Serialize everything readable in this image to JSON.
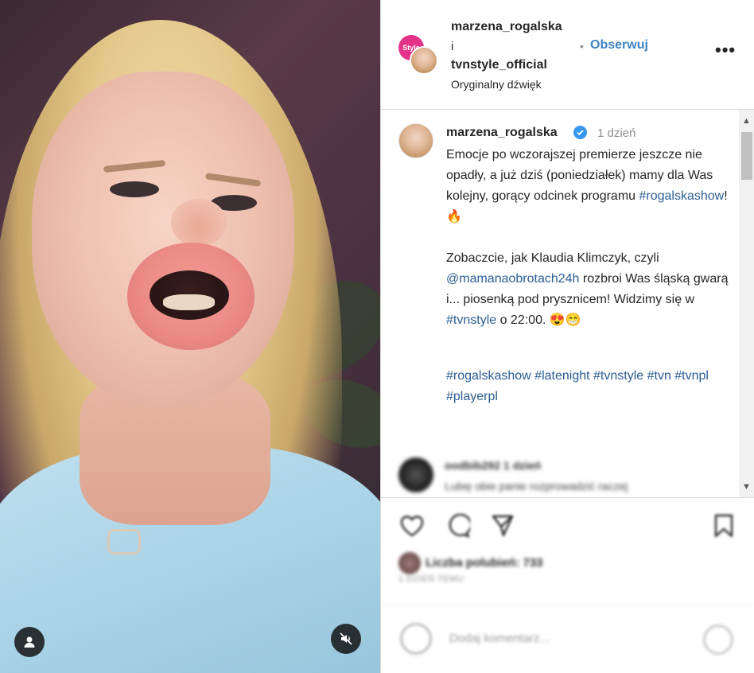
{
  "header": {
    "user1": "marzena_rogalska",
    "conjunction": "i",
    "user2": "tvnstyle_official",
    "audio": "Oryginalny dźwięk",
    "dot": "•",
    "follow_label": "Obserwuj",
    "more_label": "•••",
    "badge_text": "Style"
  },
  "caption": {
    "username": "marzena_rogalska",
    "time": "1 dzień",
    "text_part1": "Emocje po wczorajszej premierze jeszcze nie opadły, a już dziś (poniedziałek) mamy dla Was kolejny, gorący odcinek programu ",
    "hashtag1": "#rogalskashow",
    "text_part2": "! 🔥\n\nZobaczcie, jak Klaudia Klimczyk, czyli ",
    "mention": "@mamanaobrotach24h",
    "text_part3": " rozbroi Was śląską gwarą i... piosenką pod prysznicem! Widzimy się w ",
    "hashtag2": "#tvnstyle",
    "text_part4": " o 22:00. 😍😁",
    "tags": "#rogalskashow #latenight #tvnstyle #tvn #tvnpl #playerpl"
  },
  "blurred_comment": {
    "user": "oodbib292  1 dzień",
    "text": "Lubię obie panie rozprowadzić raczej"
  },
  "actions": {
    "like_icon": "heart-icon",
    "comment_icon": "comment-icon",
    "share_icon": "share-icon",
    "save_icon": "bookmark-icon",
    "likes_text": "Liczba polubień: 733",
    "age": "1 DZIEŃ TEMU"
  },
  "comment_bar": {
    "placeholder": "Dodaj komentarz..."
  },
  "colors": {
    "link": "#3b82c4",
    "hashtag": "#2a5d93",
    "verified": "#3897f0",
    "brand_pink": "#e6338a"
  }
}
